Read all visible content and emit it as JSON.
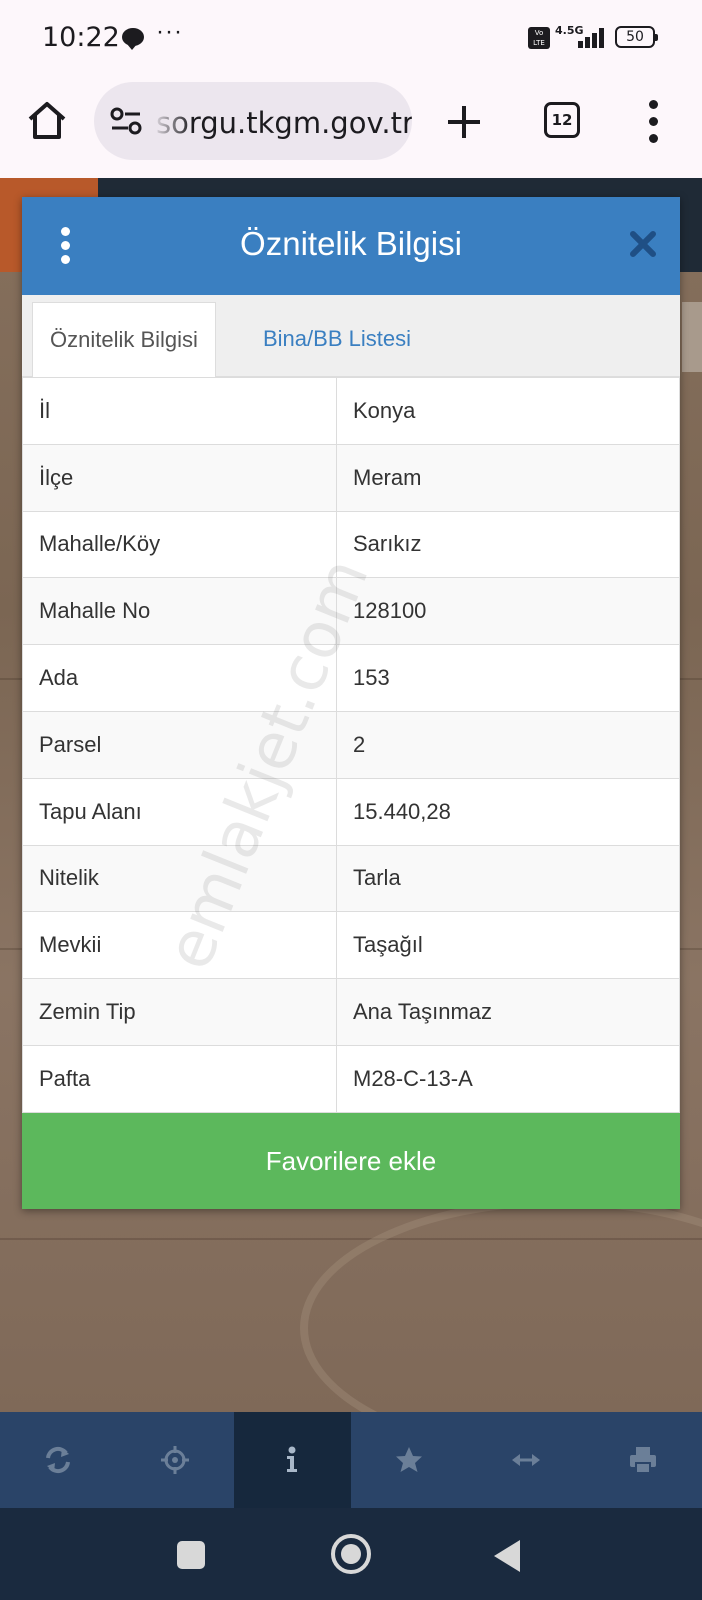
{
  "status_bar": {
    "time": "10:22",
    "more": "···",
    "volte": "Vo LTE",
    "network": "4.5G",
    "battery": "50"
  },
  "browser": {
    "url": "sorgu.tkgm.gov.tr",
    "tab_count": "12"
  },
  "modal": {
    "title": "Öznitelik Bilgisi",
    "tabs": [
      {
        "label": "Öznitelik Bilgisi",
        "active": true
      },
      {
        "label": "Bina/BB Listesi",
        "active": false
      }
    ],
    "rows": [
      {
        "key": "İl",
        "value": "Konya"
      },
      {
        "key": "İlçe",
        "value": "Meram"
      },
      {
        "key": "Mahalle/Köy",
        "value": "Sarıkız"
      },
      {
        "key": "Mahalle No",
        "value": "128100"
      },
      {
        "key": "Ada",
        "value": "153"
      },
      {
        "key": "Parsel",
        "value": "2"
      },
      {
        "key": "Tapu Alanı",
        "value": "15.440,28"
      },
      {
        "key": "Nitelik",
        "value": "Tarla"
      },
      {
        "key": "Mevkii",
        "value": "Taşağıl"
      },
      {
        "key": "Zemin Tip",
        "value": "Ana Taşınmaz"
      },
      {
        "key": "Pafta",
        "value": "M28-C-13-A"
      }
    ],
    "favorite_button": "Favorilere ekle"
  },
  "watermark": "emlakjet.com",
  "app_nav": {
    "items": [
      "refresh-icon",
      "locate-icon",
      "info-icon",
      "star-icon",
      "measure-icon",
      "print-icon"
    ],
    "active": "info-icon"
  },
  "colors": {
    "header": "#3a7fc1",
    "favorite": "#5cb85c",
    "nav": "#2a4468",
    "nav_active": "#16283d"
  }
}
